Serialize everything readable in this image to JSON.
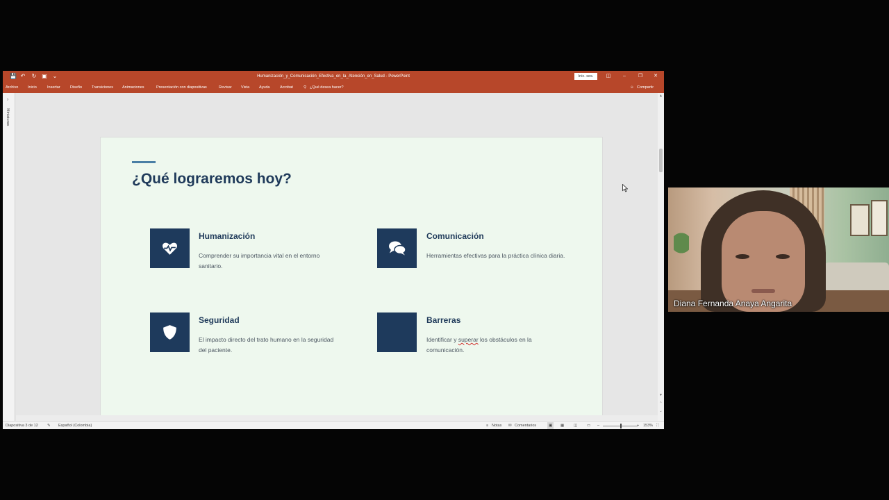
{
  "window": {
    "doc_title": "Humanización_y_Comunicación_Efectiva_en_la_Atención_en_Salud  -  PowerPoint",
    "signin_label": "Inic. ses.",
    "app_accent": "#b7472a"
  },
  "menu": {
    "items": [
      "Archivo",
      "Inicio",
      "Insertar",
      "Diseño",
      "Transiciones",
      "Animaciones",
      "Presentación con diapositivas",
      "Revisar",
      "Vista",
      "Ayuda",
      "Acrobat"
    ],
    "tell_me": "¿Qué desea hacer?",
    "share": "Compartir"
  },
  "left_pane": {
    "label": "Miniaturas"
  },
  "slide": {
    "heading": "¿Qué lograremos hoy?",
    "background": "#eef8ee",
    "icon_color": "#1e3a5c",
    "cards": [
      {
        "icon": "heart-pulse-icon",
        "title": "Humanización",
        "desc": "Comprender su importancia vital en el entorno sanitario."
      },
      {
        "icon": "chat-bubbles-icon",
        "title": "Comunicación",
        "desc": "Herramientas efectivas para la práctica clínica diaria."
      },
      {
        "icon": "shield-icon",
        "title": "Seguridad",
        "desc": "El impacto directo del trato humano en la seguridad del paciente."
      },
      {
        "icon": "blank-icon",
        "title": "Barreras",
        "desc_pre": "Identificar y ",
        "desc_underlined": "superar",
        "desc_post": " los obstáculos en la comunicación."
      }
    ]
  },
  "status": {
    "slide_counter": "Diapositiva 3 de 12",
    "language": "Español (Colombia)",
    "notes": "Notas",
    "comments": "Comentarios",
    "zoom": "153%"
  },
  "video": {
    "participant_name": "Diana Fernanda Anaya Angarita"
  }
}
